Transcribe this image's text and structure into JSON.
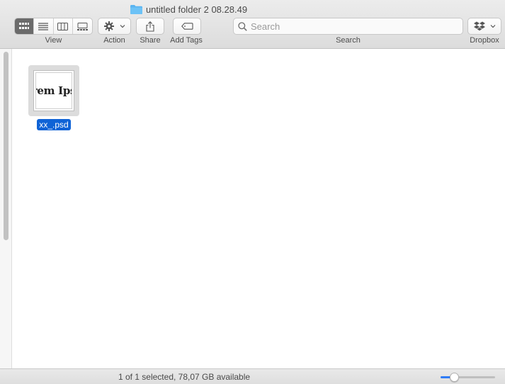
{
  "window": {
    "title": "untitled folder 2 08.28.49"
  },
  "toolbar": {
    "view_label": "View",
    "action_label": "Action",
    "share_label": "Share",
    "add_tags_label": "Add Tags",
    "search_label": "Search",
    "search_placeholder": "Search",
    "dropbox_label": "Dropbox",
    "view_modes": [
      {
        "icon": "grid-icon",
        "active": true
      },
      {
        "icon": "list-icon",
        "active": false
      },
      {
        "icon": "columns-icon",
        "active": false
      },
      {
        "icon": "gallery-icon",
        "active": false
      }
    ]
  },
  "files": [
    {
      "name": "xx_.psd",
      "thumbnail_text": "rem Ips",
      "selected": true
    }
  ],
  "status": {
    "text": "1 of 1 selected, 78,07 GB available",
    "icon_size_level": 0.25
  },
  "colors": {
    "selection": "#0f63d6",
    "slider_accent": "#2f7cf6",
    "folder": "#5ab4f0"
  }
}
